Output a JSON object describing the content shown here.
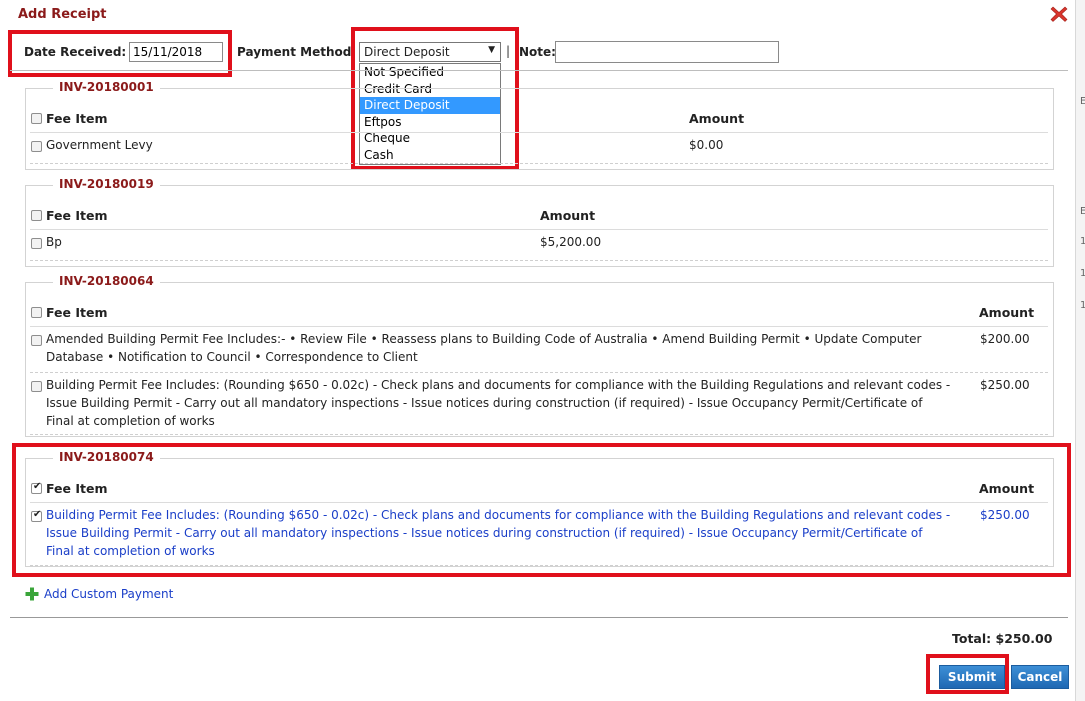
{
  "dialog": {
    "title": "Add Receipt"
  },
  "form": {
    "date_label": "Date Received:",
    "date_value": "15/11/2018",
    "payment_label": "Payment Method",
    "payment_selected": "Direct Deposit",
    "payment_options": [
      "Not Specified",
      "Credit Card",
      "Direct Deposit",
      "Eftpos",
      "Cheque",
      "Cash"
    ],
    "separator": "|",
    "note_label": "Note:",
    "note_value": ""
  },
  "invoices": [
    {
      "id": "INV-20180001",
      "header": {
        "item": "Fee Item",
        "amount": "Amount"
      },
      "items": [
        {
          "text": "Government Levy",
          "amount": "$0.00",
          "checked": false
        }
      ]
    },
    {
      "id": "INV-20180019",
      "header": {
        "item": "Fee Item",
        "amount": "Amount"
      },
      "items": [
        {
          "text": "Bp",
          "amount": "$5,200.00",
          "checked": false
        }
      ]
    },
    {
      "id": "INV-20180064",
      "header": {
        "item": "Fee Item",
        "amount": "Amount"
      },
      "items": [
        {
          "line1": "Amended Building Permit Fee Includes:- • Review File • Reassess plans to Building Code of Australia • Amend Building Permit • Update Computer",
          "line2": "Database • Notification to Council • Correspondence to Client",
          "amount": "$200.00",
          "checked": false
        },
        {
          "line1": "Building Permit Fee Includes: (Rounding $650 - 0.02c) - Check plans and documents for compliance with the Building Regulations and relevant codes -",
          "line2": "Issue Building Permit - Carry out all mandatory inspections - Issue notices during construction (if required) - Issue Occupancy Permit/Certificate of",
          "line3": "Final at completion of works",
          "amount": "$250.00",
          "checked": false
        }
      ]
    },
    {
      "id": "INV-20180074",
      "header": {
        "item": "Fee Item",
        "amount": "Amount",
        "checked": true
      },
      "items": [
        {
          "line1": "Building Permit Fee Includes: (Rounding $650 - 0.02c) - Check plans and documents for compliance with the Building Regulations and relevant codes -",
          "line2": "Issue Building Permit - Carry out all mandatory inspections - Issue notices during construction (if required) - Issue Occupancy Permit/Certificate of",
          "line3": "Final at completion of works",
          "amount": "$250.00",
          "checked": true
        }
      ]
    }
  ],
  "add_custom_payment": "Add Custom Payment",
  "total": "Total: $250.00",
  "buttons": {
    "submit": "Submit",
    "cancel": "Cancel"
  },
  "colors": {
    "accent_red": "#e0101b",
    "title_maroon": "#8b1a1a",
    "link_blue": "#1a3ec8",
    "button_blue": "#2a78c4",
    "plus_green": "#3aa53a"
  },
  "icons": {
    "close": "close-icon",
    "dropdown": "chevron-down-icon",
    "add": "plus-icon"
  },
  "background_fragments": [
    "E",
    "E",
    "1",
    "1",
    "1"
  ]
}
